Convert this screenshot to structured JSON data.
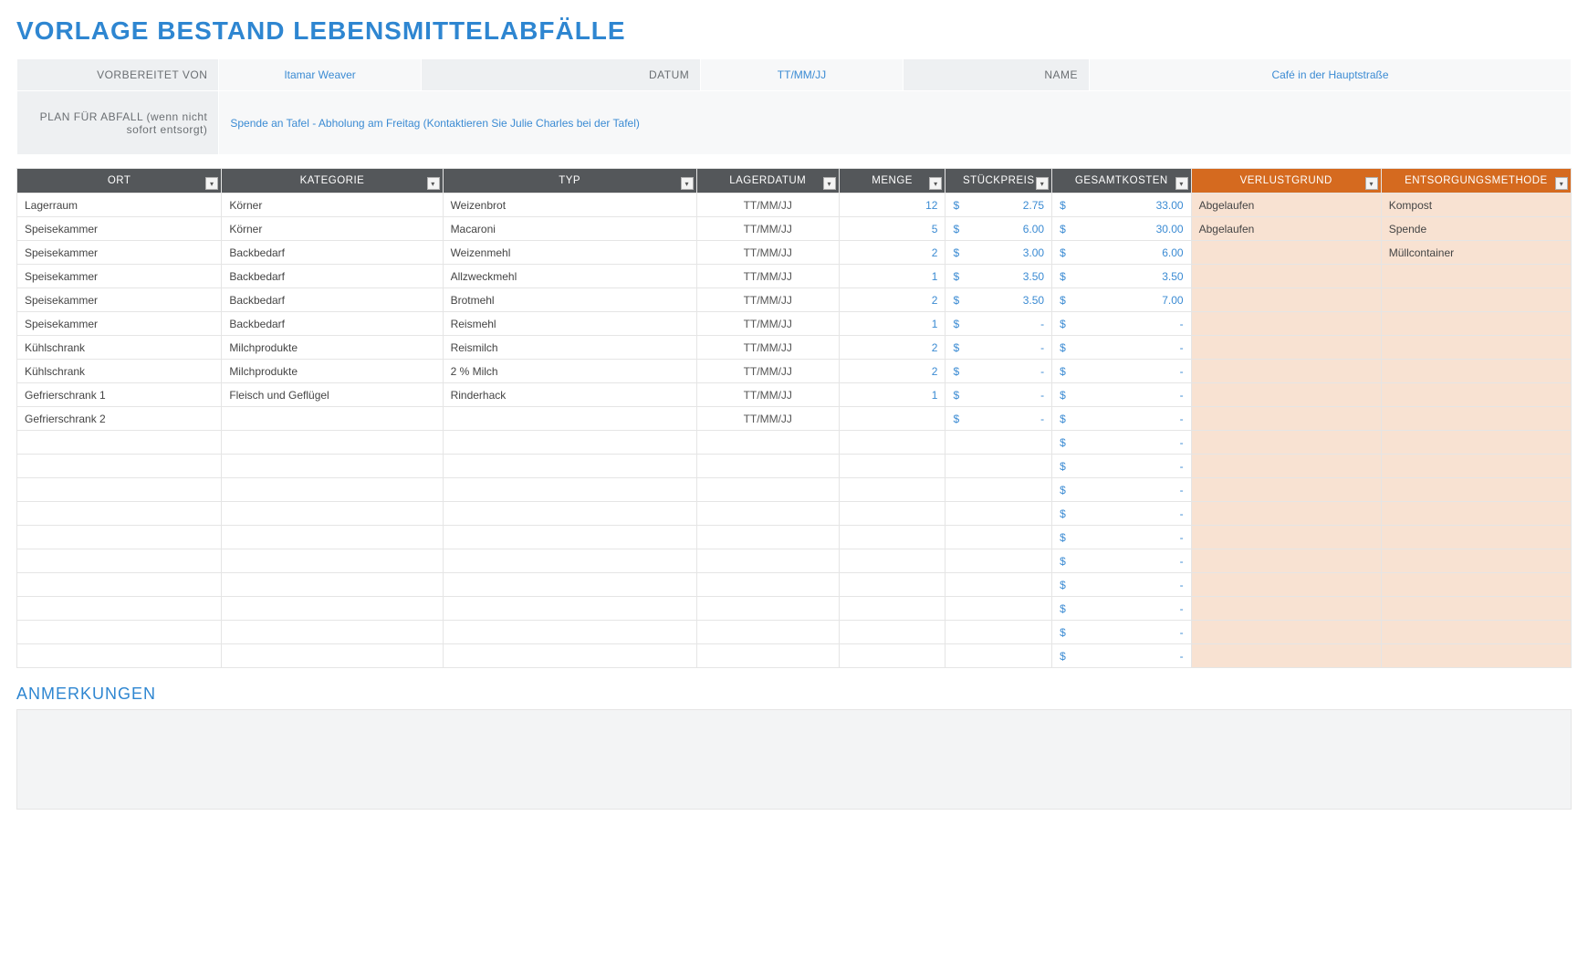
{
  "title": "VORLAGE BESTAND LEBENSMITTELABFÄLLE",
  "header": {
    "labels": {
      "prepared_by": "VORBEREITET VON",
      "date": "DATUM",
      "name": "NAME",
      "plan": "PLAN FÜR ABFALL (wenn nicht sofort entsorgt)"
    },
    "values": {
      "prepared_by": "Itamar Weaver",
      "date": "TT/MM/JJ",
      "name": "Café in der Hauptstraße",
      "plan": "Spende an Tafel - Abholung am Freitag (Kontaktieren Sie Julie Charles bei der Tafel)"
    }
  },
  "columns": {
    "ort": "ORT",
    "kategorie": "KATEGORIE",
    "typ": "TYP",
    "lagerdatum": "LAGERDATUM",
    "menge": "MENGE",
    "stueckpreis": "STÜCKPREIS",
    "gesamtkosten": "GESAMTKOSTEN",
    "verlustgrund": "VERLUSTGRUND",
    "entsorgungsmethode": "ENTSORGUNGSMETHODE"
  },
  "currency": "$",
  "dash": "-",
  "rows": [
    {
      "ort": "Lagerraum",
      "kategorie": "Körner",
      "typ": "Weizenbrot",
      "lagerdatum": "TT/MM/JJ",
      "menge": "12",
      "stueckpreis": "2.75",
      "gesamtkosten": "33.00",
      "verlustgrund": "Abgelaufen",
      "entsorgung": "Kompost"
    },
    {
      "ort": "Speisekammer",
      "kategorie": "Körner",
      "typ": "Macaroni",
      "lagerdatum": "TT/MM/JJ",
      "menge": "5",
      "stueckpreis": "6.00",
      "gesamtkosten": "30.00",
      "verlustgrund": "Abgelaufen",
      "entsorgung": "Spende"
    },
    {
      "ort": "Speisekammer",
      "kategorie": "Backbedarf",
      "typ": "Weizenmehl",
      "lagerdatum": "TT/MM/JJ",
      "menge": "2",
      "stueckpreis": "3.00",
      "gesamtkosten": "6.00",
      "verlustgrund": "",
      "entsorgung": "Müllcontainer"
    },
    {
      "ort": "Speisekammer",
      "kategorie": "Backbedarf",
      "typ": "Allzweckmehl",
      "lagerdatum": "TT/MM/JJ",
      "menge": "1",
      "stueckpreis": "3.50",
      "gesamtkosten": "3.50",
      "verlustgrund": "",
      "entsorgung": ""
    },
    {
      "ort": "Speisekammer",
      "kategorie": "Backbedarf",
      "typ": "Brotmehl",
      "lagerdatum": "TT/MM/JJ",
      "menge": "2",
      "stueckpreis": "3.50",
      "gesamtkosten": "7.00",
      "verlustgrund": "",
      "entsorgung": ""
    },
    {
      "ort": "Speisekammer",
      "kategorie": "Backbedarf",
      "typ": "Reismehl",
      "lagerdatum": "TT/MM/JJ",
      "menge": "1",
      "stueckpreis": "",
      "gesamtkosten": "",
      "verlustgrund": "",
      "entsorgung": ""
    },
    {
      "ort": "Kühlschrank",
      "kategorie": "Milchprodukte",
      "typ": "Reismilch",
      "lagerdatum": "TT/MM/JJ",
      "menge": "2",
      "stueckpreis": "",
      "gesamtkosten": "",
      "verlustgrund": "",
      "entsorgung": ""
    },
    {
      "ort": "Kühlschrank",
      "kategorie": "Milchprodukte",
      "typ": "2 % Milch",
      "lagerdatum": "TT/MM/JJ",
      "menge": "2",
      "stueckpreis": "",
      "gesamtkosten": "",
      "verlustgrund": "",
      "entsorgung": ""
    },
    {
      "ort": "Gefrierschrank 1",
      "kategorie": "Fleisch und Geflügel",
      "typ": "Rinderhack",
      "lagerdatum": "TT/MM/JJ",
      "menge": "1",
      "stueckpreis": "",
      "gesamtkosten": "",
      "verlustgrund": "",
      "entsorgung": ""
    },
    {
      "ort": "Gefrierschrank 2",
      "kategorie": "",
      "typ": "",
      "lagerdatum": "TT/MM/JJ",
      "menge": "",
      "stueckpreis": "",
      "gesamtkosten": "",
      "verlustgrund": "",
      "entsorgung": ""
    }
  ],
  "blank_rows": 10,
  "notes_title": "ANMERKUNGEN",
  "notes_value": ""
}
